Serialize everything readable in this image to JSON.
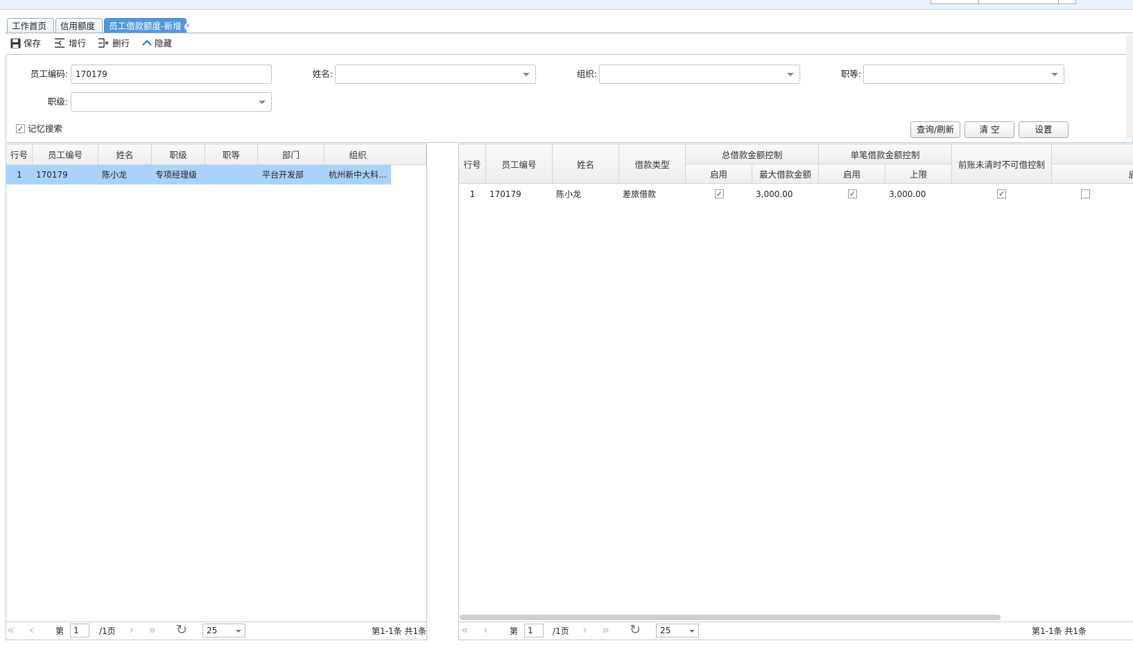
{
  "tabs": [
    {
      "label": "工作首页"
    },
    {
      "label": "信用额度"
    },
    {
      "label": "员工借款额度-新增"
    }
  ],
  "toolbar": {
    "save": "保存",
    "add_row": "增行",
    "del_row": "删行",
    "hide": "隐藏"
  },
  "form": {
    "emp_code_label": "员工编码:",
    "emp_code_value": "170179",
    "name_label": "姓名:",
    "org_label": "组织:",
    "grade_label": "职等:",
    "level_label": "职级:",
    "remember_label": "记忆搜索",
    "remember_checked": true,
    "query_btn": "查询/刷新",
    "clear_btn": "清 空",
    "settings_btn": "设置"
  },
  "left_grid": {
    "columns": [
      "行号",
      "员工编号",
      "姓名",
      "职级",
      "职等",
      "部门",
      "组织"
    ],
    "rows": [
      {
        "no": "1",
        "code": "170179",
        "name": "陈小龙",
        "level": "专项经理级",
        "grade": "",
        "dept": "平台开发部",
        "org": "杭州新中大科..."
      }
    ],
    "pager": {
      "page_prefix": "第",
      "page": "1",
      "page_suffix": "/1页",
      "size": "25",
      "summary": "第1-1条 共1条"
    }
  },
  "right_grid": {
    "columns": {
      "no": "行号",
      "code": "员工编号",
      "name": "姓名",
      "type": "借款类型",
      "total_group": "总借款金额控制",
      "total_enable": "启用",
      "total_max": "最大借款金额",
      "single_group": "单笔借款金额控制",
      "single_enable": "启用",
      "single_limit": "上限",
      "unsettled": "前账未清时不可借控制",
      "extra": "启"
    },
    "rows": [
      {
        "no": "1",
        "code": "170179",
        "name": "陈小龙",
        "type": "差旅借款",
        "total_enable": true,
        "total_max": "3,000.00",
        "single_enable": true,
        "single_limit": "3,000.00",
        "unsettled": true,
        "extra": false
      }
    ],
    "pager": {
      "page_prefix": "第",
      "page": "1",
      "page_suffix": "/1页",
      "size": "25",
      "summary": "第1-1条 共1条"
    }
  }
}
